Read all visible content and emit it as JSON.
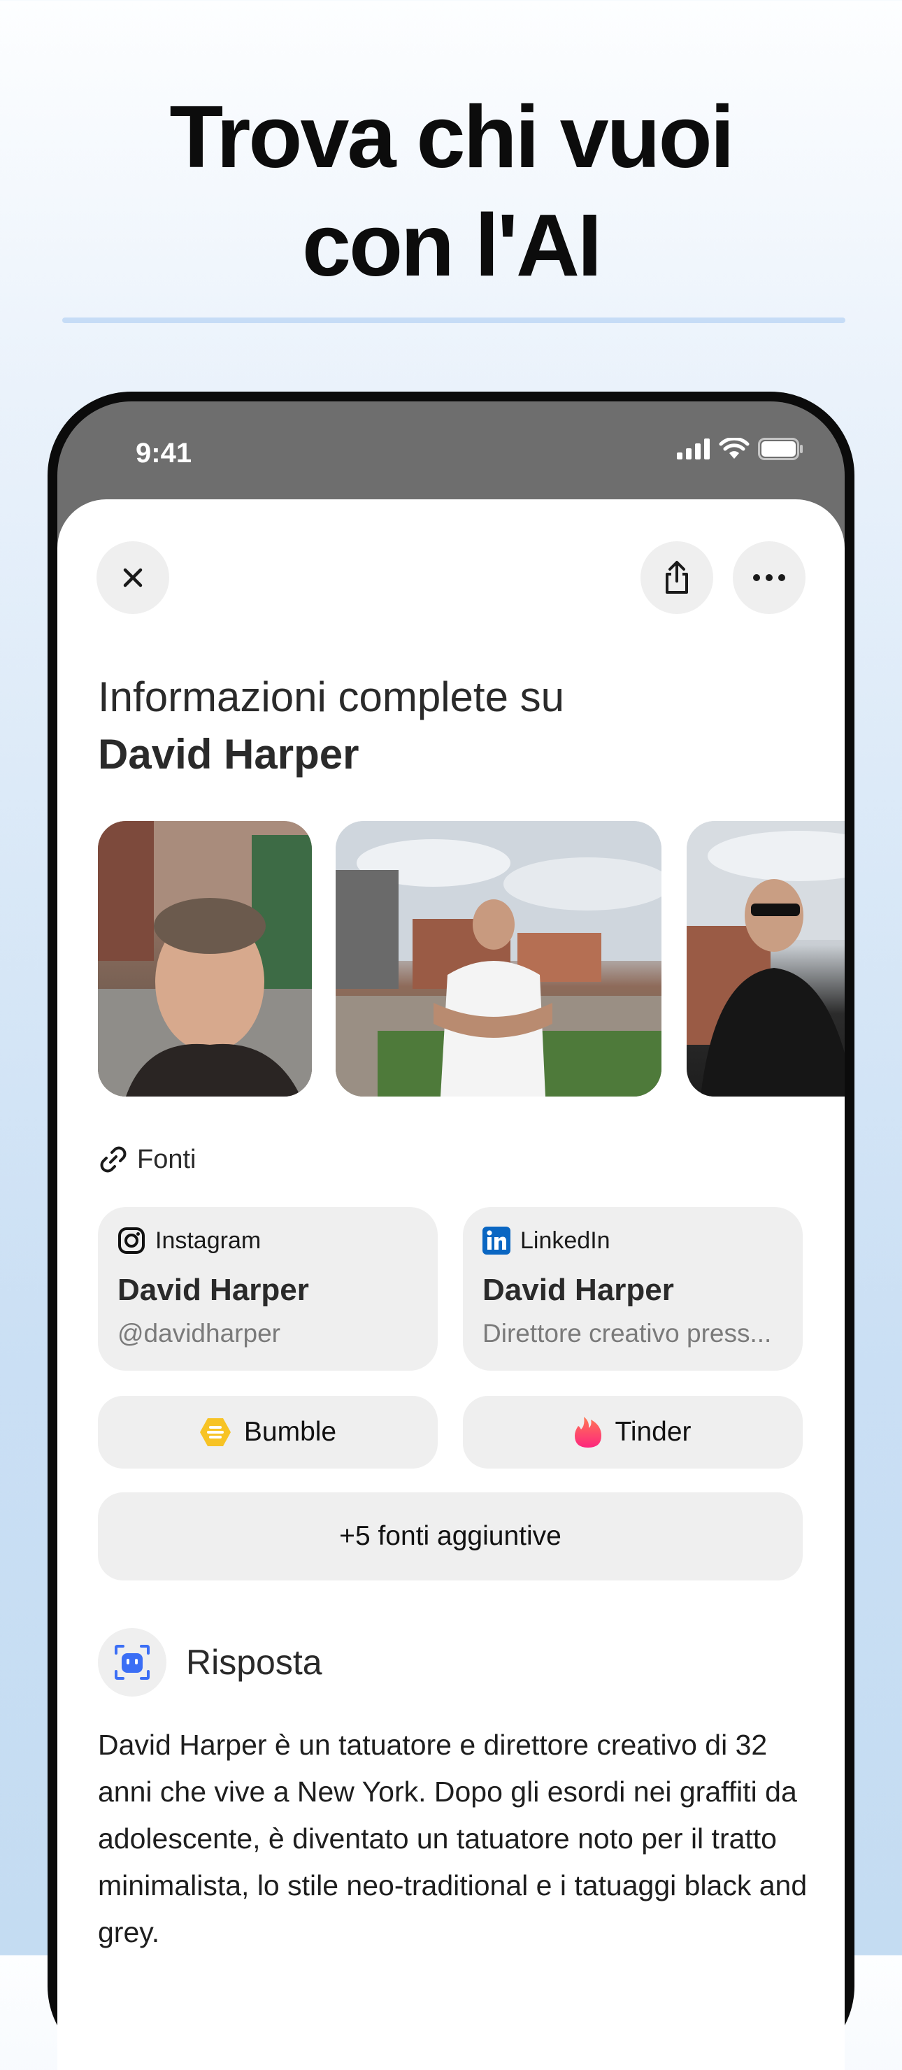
{
  "headline": {
    "line1": "Trova chi vuoi",
    "line2": "con l'AI"
  },
  "status_bar": {
    "time": "9:41",
    "icons": [
      "signal-icon",
      "wifi-icon",
      "battery-icon"
    ]
  },
  "toolbar": {
    "close_icon": "close-icon",
    "share_icon": "share-icon",
    "more_icon": "more-icon"
  },
  "profile": {
    "title_prefix": "Informazioni complete su",
    "name": "David Harper",
    "photo_count_visible": 3
  },
  "sources": {
    "label": "Fonti",
    "icon": "link-icon",
    "cards": [
      {
        "platform": "Instagram",
        "icon": "instagram-icon",
        "name": "David Harper",
        "subtitle": "@davidharper"
      },
      {
        "platform": "LinkedIn",
        "icon": "linkedin-icon",
        "name": "David Harper",
        "subtitle": "Direttore creativo press..."
      }
    ],
    "pills": [
      {
        "label": "Bumble",
        "icon": "bumble-icon"
      },
      {
        "label": "Tinder",
        "icon": "tinder-icon"
      }
    ],
    "more_label": "+5 fonti aggiuntive"
  },
  "answer": {
    "title": "Risposta",
    "icon": "ai-assistant-icon",
    "text": "David Harper è un tatuatore e direttore creativo di 32 anni che vive a New York. Dopo gli esordi nei graffiti da adolescente, è diventato un tatuatore noto per il tratto minimalista, lo stile neo-traditional e i tatuaggi black and grey."
  },
  "colors": {
    "accent_blue": "#3b6ef5",
    "linkedin_blue": "#0a66c2",
    "bumble_yellow": "#f7c325",
    "tinder_pink": "#fd3a6b",
    "headline_rule": "#c6dcf6"
  }
}
